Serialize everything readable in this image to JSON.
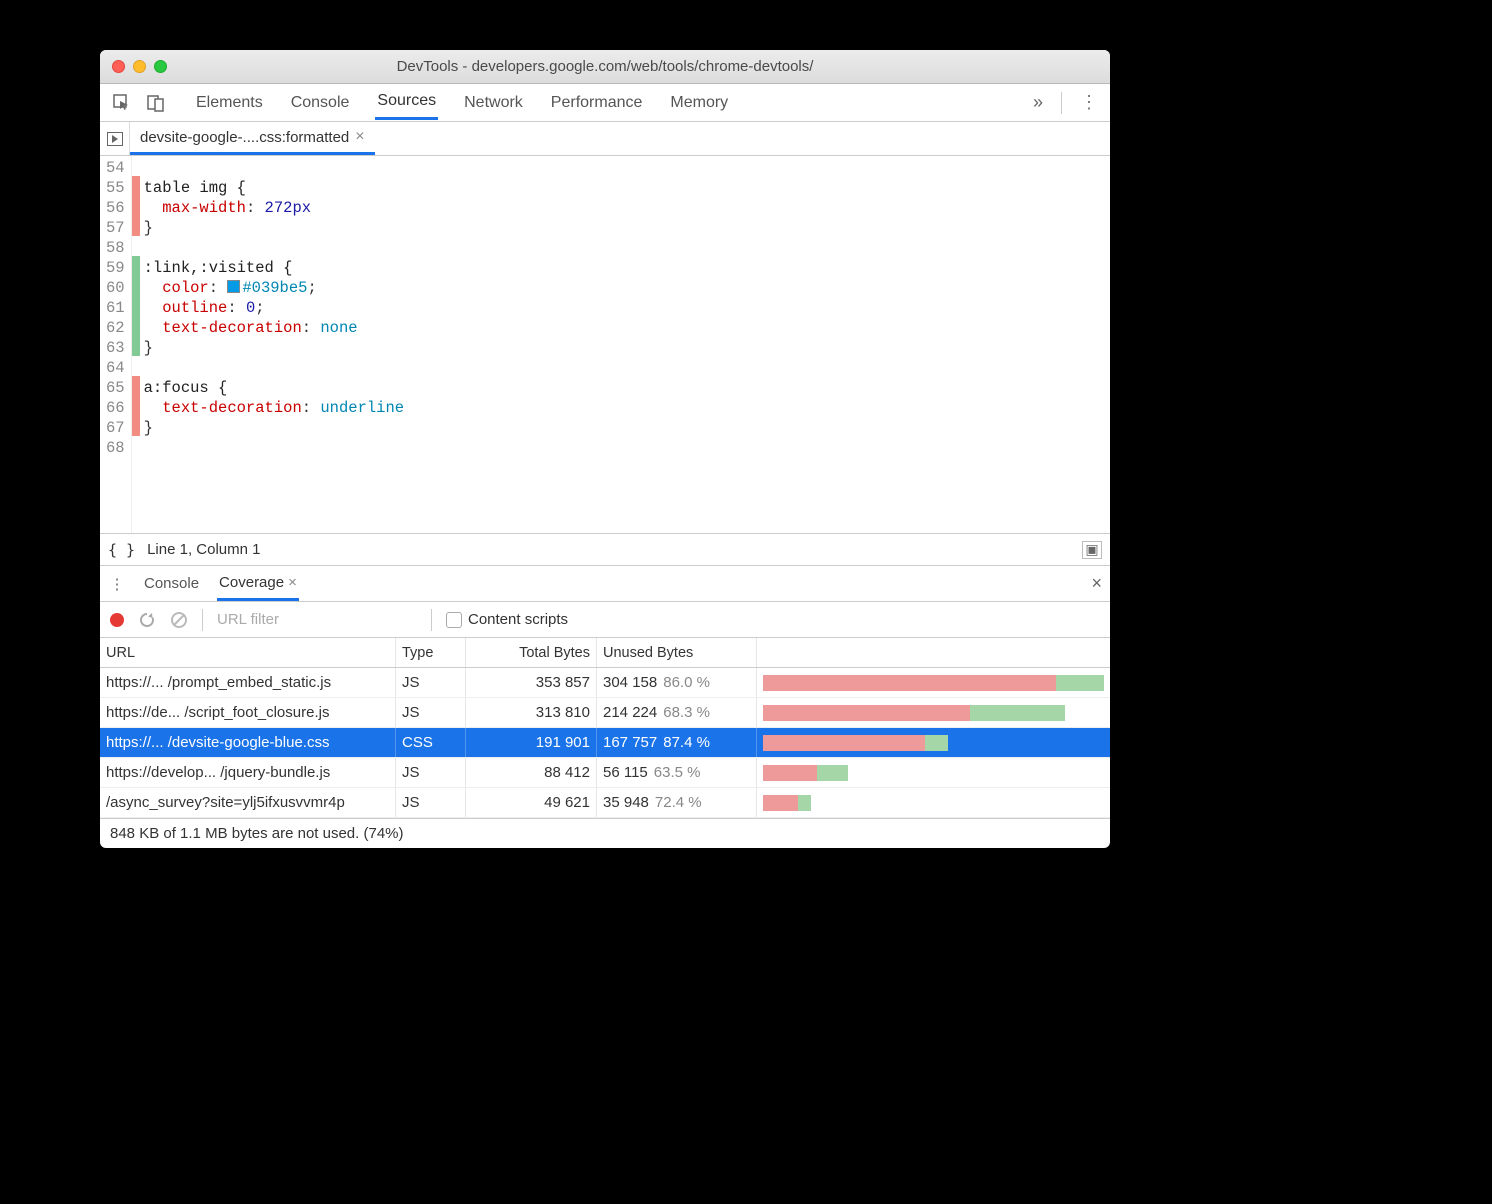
{
  "title": "DevTools - developers.google.com/web/tools/chrome-devtools/",
  "mainTabs": [
    "Elements",
    "Console",
    "Sources",
    "Network",
    "Performance",
    "Memory"
  ],
  "activeMainTab": "Sources",
  "fileTab": {
    "label": "devsite-google-....css:formatted"
  },
  "code": {
    "firstLine": 54,
    "lines": [
      {
        "n": 54,
        "cov": "",
        "html": ""
      },
      {
        "n": 55,
        "cov": "r",
        "html": "<span class='tok-sel'>table img {</span>"
      },
      {
        "n": 56,
        "cov": "r",
        "html": "  <span class='tok-prop'>max-width</span>: <span class='tok-num'>272px</span>"
      },
      {
        "n": 57,
        "cov": "r",
        "html": "}"
      },
      {
        "n": 58,
        "cov": "",
        "html": ""
      },
      {
        "n": 59,
        "cov": "g",
        "html": "<span class='tok-sel'>:link,:visited {</span>"
      },
      {
        "n": 60,
        "cov": "g",
        "html": "  <span class='tok-prop'>color</span>: <span class='swatch' style='background:#039be5'></span><span class='tok-kw'>#039be5</span>;"
      },
      {
        "n": 61,
        "cov": "g",
        "html": "  <span class='tok-prop'>outline</span>: <span class='tok-num'>0</span>;"
      },
      {
        "n": 62,
        "cov": "g",
        "html": "  <span class='tok-prop'>text-decoration</span>: <span class='tok-kw'>none</span>"
      },
      {
        "n": 63,
        "cov": "g",
        "html": "}"
      },
      {
        "n": 64,
        "cov": "",
        "html": ""
      },
      {
        "n": 65,
        "cov": "r",
        "html": "<span class='tok-sel'>a:focus {</span>"
      },
      {
        "n": 66,
        "cov": "r",
        "html": "  <span class='tok-prop'>text-decoration</span>: <span class='tok-kw'>underline</span>"
      },
      {
        "n": 67,
        "cov": "r",
        "html": "}"
      },
      {
        "n": 68,
        "cov": "",
        "html": ""
      }
    ]
  },
  "status": {
    "pretty": "{ }",
    "position": "Line 1, Column 1"
  },
  "drawerTabs": [
    "Console",
    "Coverage"
  ],
  "activeDrawerTab": "Coverage",
  "covToolbar": {
    "urlFilterPlaceholder": "URL filter",
    "contentScriptsLabel": "Content scripts"
  },
  "covHeaders": [
    "URL",
    "Type",
    "Total Bytes",
    "Unused Bytes"
  ],
  "maxTotal": 353857,
  "rows": [
    {
      "url": "https://... /prompt_embed_static.js",
      "type": "JS",
      "total": "353 857",
      "totalNum": 353857,
      "unused": "304 158",
      "pct": "86.0 %",
      "unusedFrac": 0.86,
      "sel": false
    },
    {
      "url": "https://de... /script_foot_closure.js",
      "type": "JS",
      "total": "313 810",
      "totalNum": 313810,
      "unused": "214 224",
      "pct": "68.3 %",
      "unusedFrac": 0.683,
      "sel": false
    },
    {
      "url": "https://... /devsite-google-blue.css",
      "type": "CSS",
      "total": "191 901",
      "totalNum": 191901,
      "unused": "167 757",
      "pct": "87.4 %",
      "unusedFrac": 0.874,
      "sel": true
    },
    {
      "url": "https://develop... /jquery-bundle.js",
      "type": "JS",
      "total": "88 412",
      "totalNum": 88412,
      "unused": "56 115",
      "pct": "63.5 %",
      "unusedFrac": 0.635,
      "sel": false
    },
    {
      "url": "/async_survey?site=ylj5ifxusvvmr4p",
      "type": "JS",
      "total": "49 621",
      "totalNum": 49621,
      "unused": "35 948",
      "pct": "72.4 %",
      "unusedFrac": 0.724,
      "sel": false
    }
  ],
  "footer": "848 KB of 1.1 MB bytes are not used. (74%)"
}
